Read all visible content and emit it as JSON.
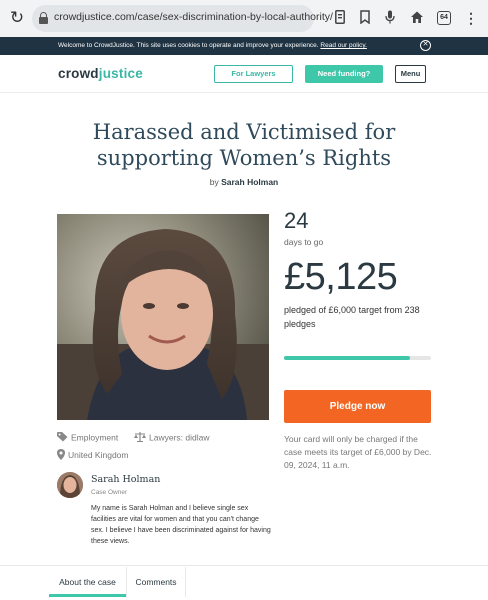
{
  "browser": {
    "url": "crowdjustice.com/case/sex-discrimination-by-local-authority/",
    "tab_count": "64"
  },
  "cookie_banner": {
    "text": "Welcome to CrowdJustice. This site uses cookies to operate and improve your experience.",
    "link": "Read our policy."
  },
  "header": {
    "logo_part1": "crowd",
    "logo_part2": "justice",
    "for_lawyers": "For Lawyers",
    "need_funding": "Need funding?",
    "menu": "Menu"
  },
  "case": {
    "title": "Harassed and Victimised for supporting Women’s Rights",
    "by_prefix": "by",
    "author": "Sarah Holman",
    "days_left": "24",
    "days_label": "days to go",
    "amount": "£5,125",
    "pledged_text": "pledged of £6,000 target from 238 pledges",
    "progress_fraction": 0.854,
    "pledge_button": "Pledge now",
    "card_note": "Your card will only be charged if the case meets its target of £6,000 by Dec. 09, 2024, 11 a.m."
  },
  "tags": {
    "category": "Employment",
    "lawyers": "Lawyers: didlaw",
    "location": "United Kingdom"
  },
  "owner": {
    "name": "Sarah Holman",
    "role": "Case Owner",
    "bio": "My name is Sarah Holman and I believe single sex facilities are vital for women and that you can't change sex. I believe I have been discriminated against for having these views."
  },
  "tabs": {
    "about": "About the case",
    "comments": "Comments"
  },
  "colors": {
    "brand_teal": "#3ec7a8",
    "pledge_orange": "#f26522",
    "navy": "#203342"
  }
}
